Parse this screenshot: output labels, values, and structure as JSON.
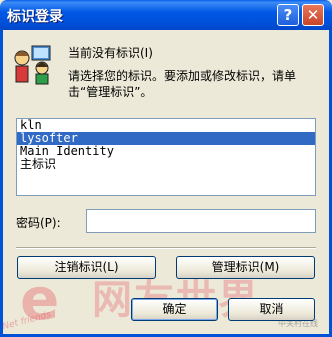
{
  "window": {
    "title": "标识登录",
    "help_glyph": "?",
    "close_glyph": "✕"
  },
  "header": {
    "line1": "当前没有标识(I)",
    "line2": "请选择您的标识。要添加或修改标识，请单击“管理标识”。"
  },
  "identities": [
    {
      "label": "kln",
      "selected": false
    },
    {
      "label": "lysofter",
      "selected": true
    },
    {
      "label": "Main Identity",
      "selected": false
    },
    {
      "label": "主标识",
      "selected": false
    }
  ],
  "password": {
    "label": "密码(P):",
    "value": ""
  },
  "buttons": {
    "logout": "注销标识(L)",
    "manage": "管理标识(M)",
    "ok": "确定",
    "cancel": "取消"
  },
  "watermark": {
    "logo": "e",
    "text": "网友世界",
    "sub": "Net friends",
    "corner": "中关村在线"
  },
  "colors": {
    "titlebar": "#0058e6",
    "selection": "#316ac5",
    "dialog_bg": "#ece9d8"
  }
}
